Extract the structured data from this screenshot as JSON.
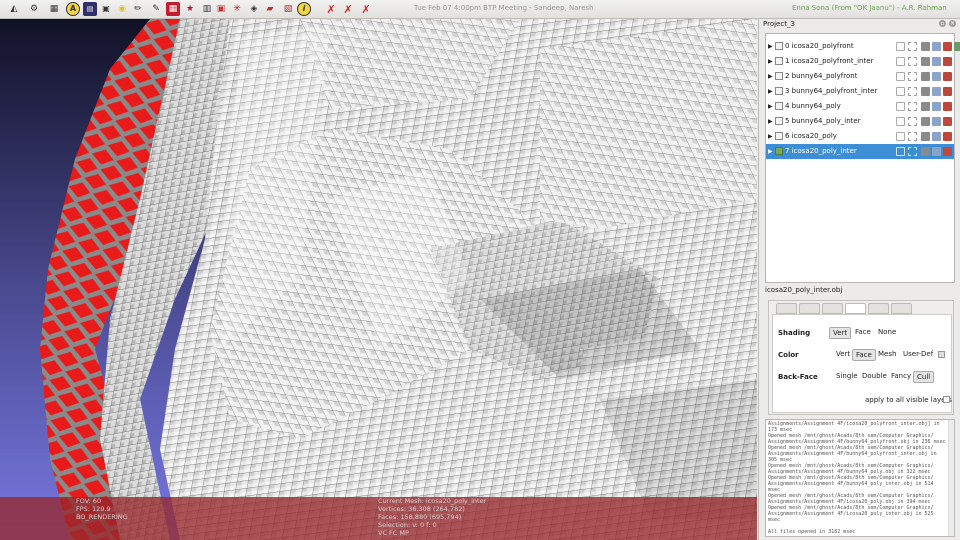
{
  "topbar": {
    "clock": "Tue Feb 07  4:00pm  BTP Meeting - Sandeep, Naresh",
    "mail_note": "Enna Sona (From \"OK Jaanu\") - A.R. Rahman",
    "tools": [
      "disk-icon",
      "settings-icon",
      "grid-icon",
      "auto-icon",
      "info-box-icon",
      "colors-icon",
      "ink-icon",
      "pen-icon",
      "layer-icon",
      "plugin-icon",
      "cluster-icon",
      "splat-icon",
      "flip-icon",
      "sphere-icon",
      "compass-icon",
      "help-icon",
      "cross-1-icon",
      "cross-2-icon",
      "cross-3-icon"
    ]
  },
  "viewport": {
    "hud": {
      "fov": "FOV: 60",
      "fps": "FPS:    129.9",
      "mode": "BO_RENDERING",
      "current_mesh": "Current Mesh: icosa20_poly_inter",
      "vertices": "Vertices: 36,308     (264,782)",
      "faces": "Faces: 158,880     (695,794)",
      "selection": "Selection: v: 0 f: 0",
      "flags": "VC FC MP"
    }
  },
  "panel": {
    "project_title": "Project_3",
    "layers": [
      {
        "label": "0  icosa20_polyfront",
        "visible": false,
        "selected": false
      },
      {
        "label": "1  icosa20_polyfront_inter",
        "visible": false,
        "selected": false
      },
      {
        "label": "2  bunny64_polyfront",
        "visible": false,
        "selected": false
      },
      {
        "label": "3  bunny64_polyfront_inter",
        "visible": false,
        "selected": false
      },
      {
        "label": "4  bunny64_poly",
        "visible": false,
        "selected": false
      },
      {
        "label": "5  bunny64_poly_inter",
        "visible": false,
        "selected": false
      },
      {
        "label": "6  icosa20_poly",
        "visible": false,
        "selected": false
      },
      {
        "label": "7  icosa20_poly_inter",
        "visible": true,
        "selected": true
      }
    ],
    "file_label": "icosa20_poly_inter.obj",
    "shading": {
      "label": "Shading",
      "options": [
        "Vert",
        "Face",
        "None"
      ],
      "selected": "Vert"
    },
    "color": {
      "label": "Color",
      "options": [
        "Vert",
        "Face",
        "Mesh",
        "User-Def"
      ],
      "selected": "Face"
    },
    "backface": {
      "label": "Back-Face",
      "options": [
        "Single",
        "Double",
        "Fancy",
        "Cull"
      ],
      "selected": "Cull"
    },
    "apply_all": "apply to all visible layers",
    "log": "Assignments/Assignment 4F/icosa20_polyfront_inter.obj] in\n173 msec\nOpened mesh /mnt/ghost/Acads/8th sem/Computer Graphics/\nAssignments/Assignment 4F/bunny64_polyfront.obj in 236 msec\nOpened mesh /mnt/ghost/Acads/8th sem/Computer Graphics/\nAssignments/Assignment 4F/bunny64_polyfront_inter.obj in\n305 msec\nOpened mesh /mnt/ghost/Acads/8th sem/Computer Graphics/\nAssignments/Assignment 4F/bunny64_poly.obj in 322 msec\nOpened mesh /mnt/ghost/Acads/8th sem/Computer Graphics/\nAssignments/Assignment 4F/bunny64_poly_inter.obj in 514\nmsec\nOpened mesh /mnt/ghost/Acads/8th sem/Computer Graphics/\nAssignments/Assignment 4F/icosa20_poly.obj in 394 msec\nOpened mesh /mnt/ghost/Acads/8th sem/Computer Graphics/\nAssignments/Assignment 4F/icosa20_poly_inter.obj in 525\nmsec\n\nAll files opened in 3182 msec"
  },
  "colors": {
    "selection": "#3c8fd6",
    "mesh_red": "#e01818",
    "hud_band": "#962d2d",
    "mail_note": "#6aa84f"
  }
}
